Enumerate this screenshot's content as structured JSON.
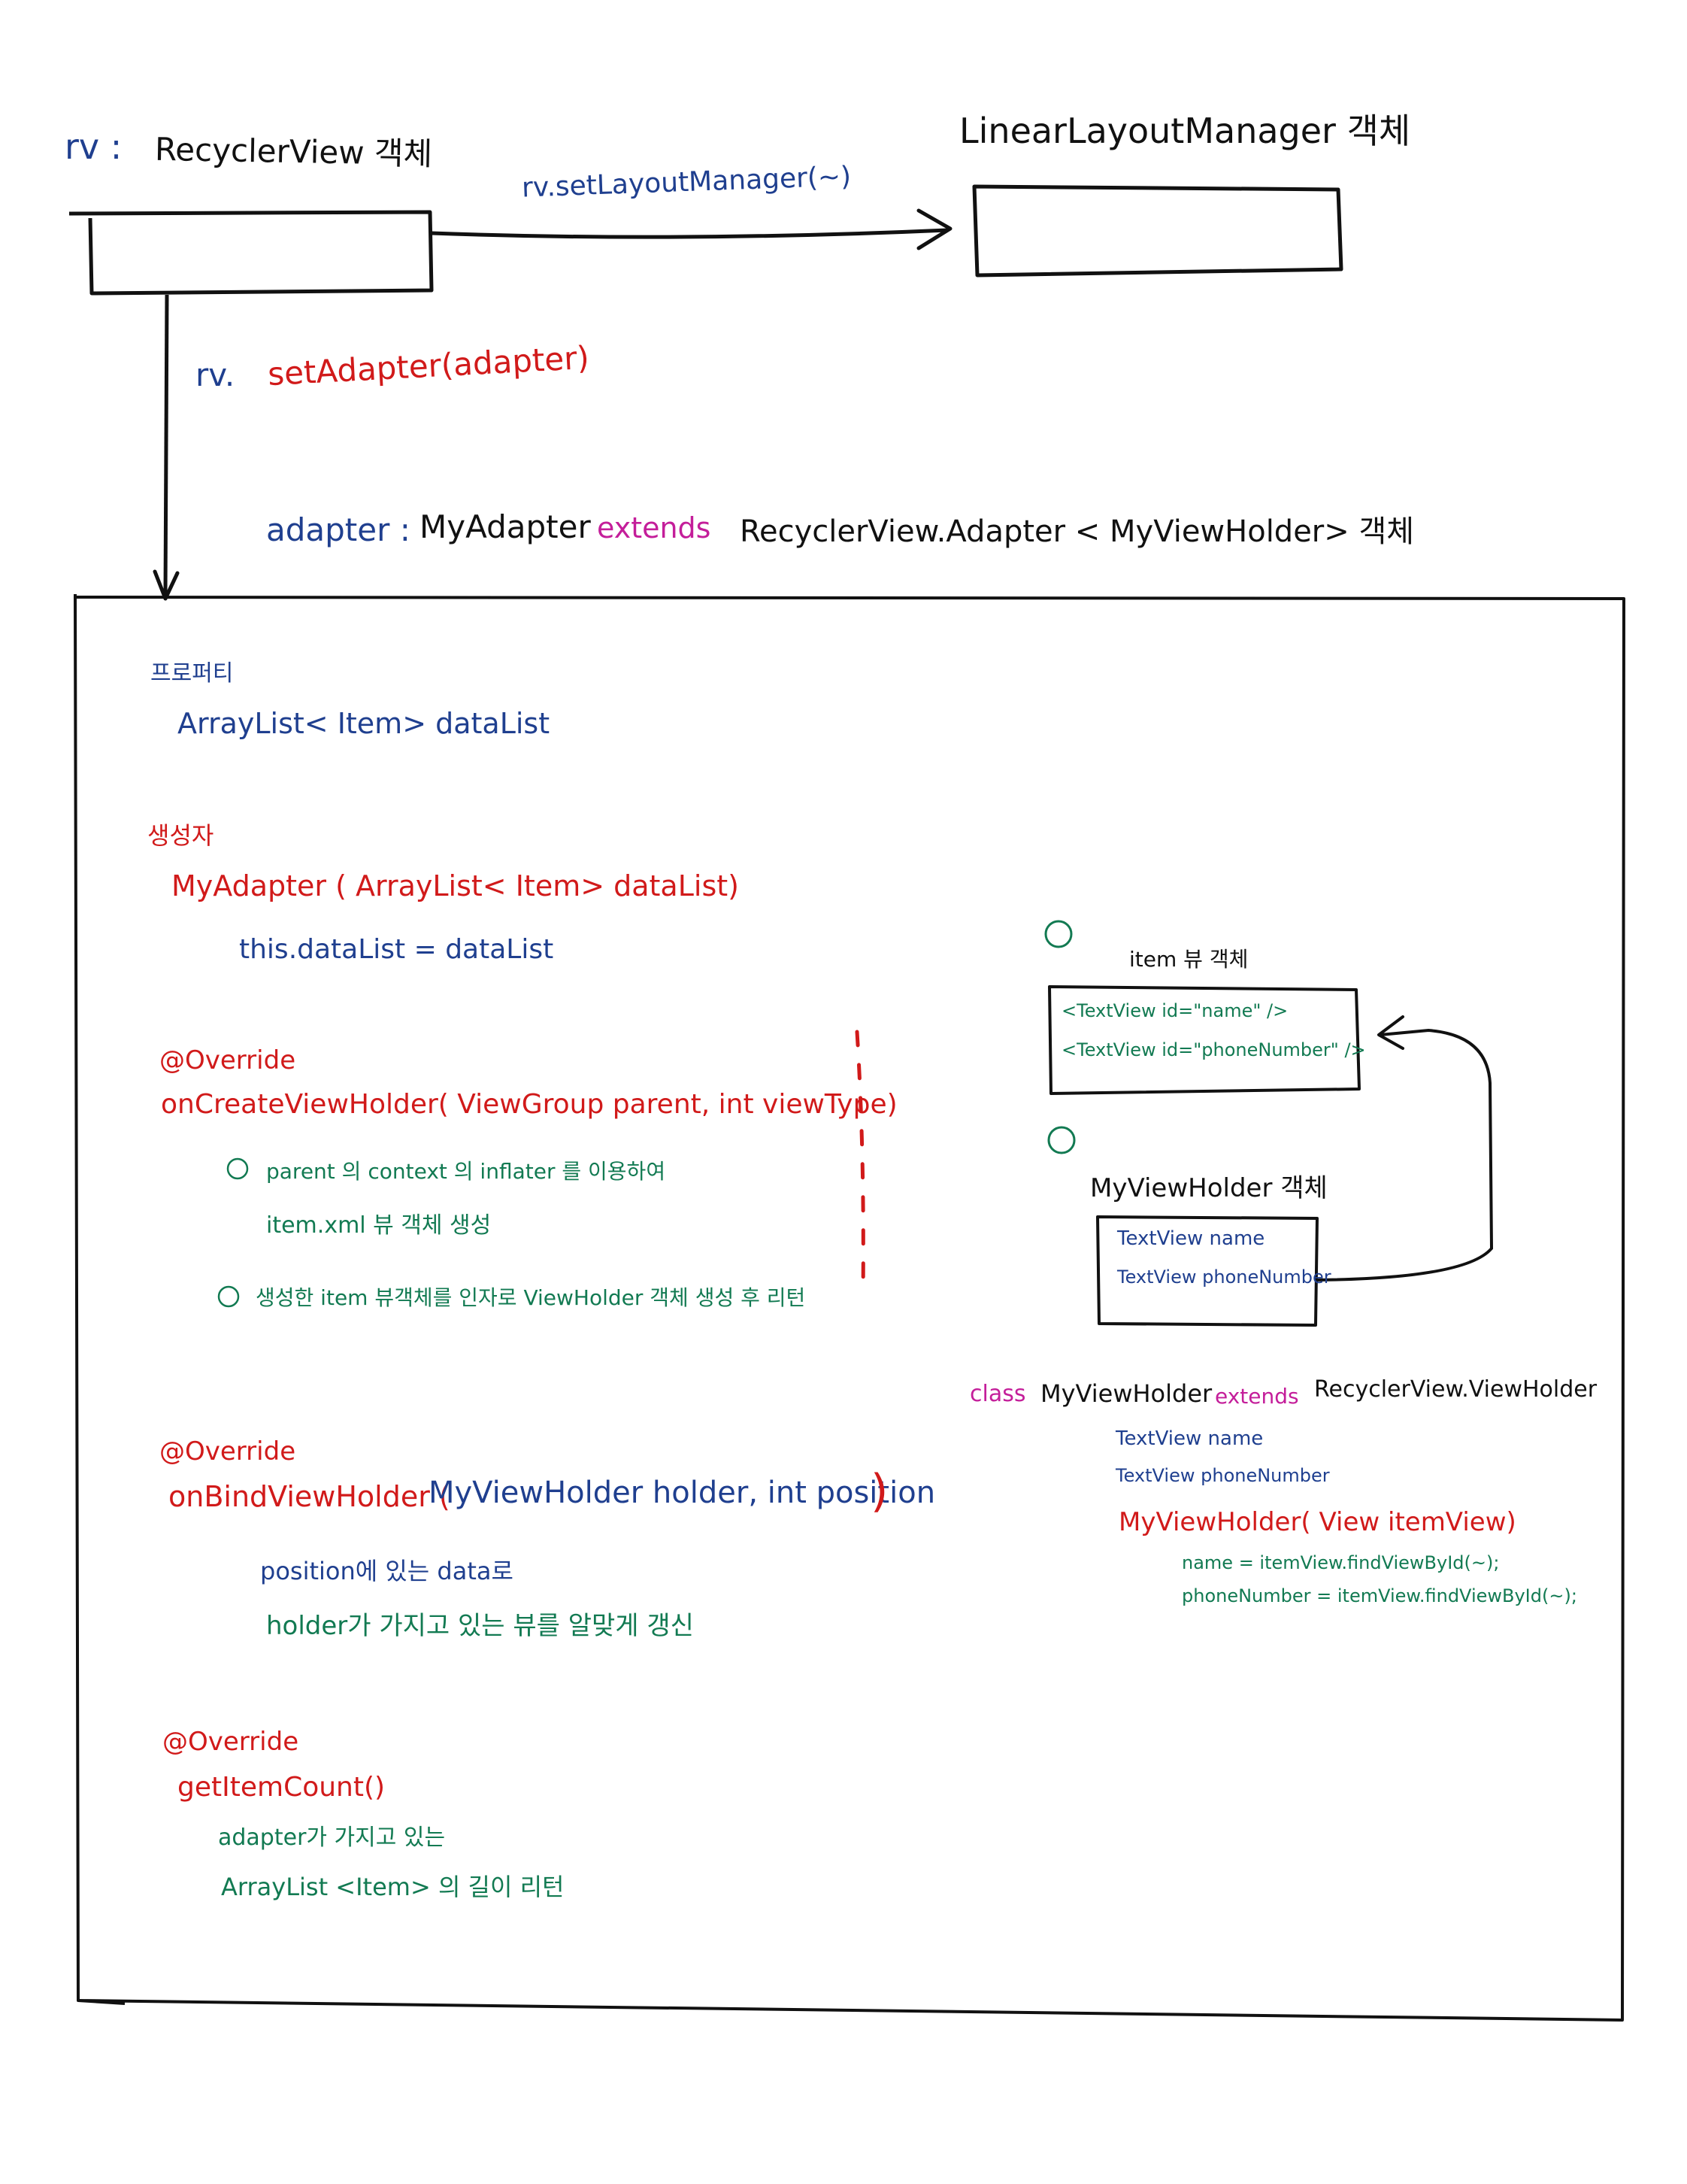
{
  "colors": {
    "ink": "#111111",
    "blue": "#1f3f8f",
    "red": "#d11a1a",
    "green": "#127a52",
    "magenta": "#c41e9a"
  },
  "top": {
    "rv_prefix": "rv :",
    "rv_label": "RecyclerView 객체",
    "llm_label": "LinearLayoutManager 객체",
    "set_layout_call": "rv.setLayoutManager(~)",
    "set_adapter_prefix": "rv.",
    "set_adapter_call": "setAdapter(adapter)"
  },
  "adapter_heading": {
    "var": "adapter :",
    "class": "MyAdapter",
    "extends": "extends",
    "parent": "RecyclerView.Adapter < MyViewHolder> 객체"
  },
  "adapter_body": {
    "property_heading": "프로퍼티",
    "property_line": "ArrayList< Item> dataList",
    "constructor_heading": "생성자",
    "constructor_sig": "MyAdapter ( ArrayList< Item> dataList)",
    "constructor_body": "this.dataList = dataList",
    "on_create": {
      "annotation": "@Override",
      "signature": "onCreateViewHolder( ViewGroup parent, int viewType)",
      "step1_num": "①",
      "step1_line1": "parent 의 context 의 inflater 를 이용하여",
      "step1_line2": "item.xml 뷰 객체 생성",
      "step2_num": "②",
      "step2_line": "생성한 item 뷰객체를 인자로 ViewHolder 객체 생성 후 리턴"
    },
    "on_bind": {
      "annotation": "@Override",
      "signature_prefix": "onBindViewHolder (",
      "signature_params": "MyViewHolder holder, int position",
      "signature_suffix": ")",
      "line1": "position에 있는 data로",
      "line2": "holder가 가지고 있는 뷰를 알맞게 갱신"
    },
    "get_count": {
      "annotation": "@Override",
      "signature": "getItemCount()",
      "line1": "adapter가 가지고 있는",
      "line2": "ArrayList <Item> 의 길이 리턴"
    }
  },
  "right_panel": {
    "step1": "①",
    "item_view_label": "item 뷰 객체",
    "item_view_lines": [
      "<TextView id=\"name\" />",
      "<TextView id=\"phoneNumber\" />"
    ],
    "step2": "②",
    "holder_label": "MyViewHolder 객체",
    "holder_lines": [
      "TextView name",
      "TextView phoneNumber"
    ]
  },
  "viewholder_class": {
    "class_kw": "class",
    "class_name": "MyViewHolder",
    "extends": "extends",
    "parent": "RecyclerView.ViewHolder",
    "field1": "TextView name",
    "field2": "TextView phoneNumber",
    "constructor_sig": "MyViewHolder( View itemView)",
    "body1": "name = itemView.findViewById(~);",
    "body2": "phoneNumber = itemView.findViewById(~);"
  }
}
